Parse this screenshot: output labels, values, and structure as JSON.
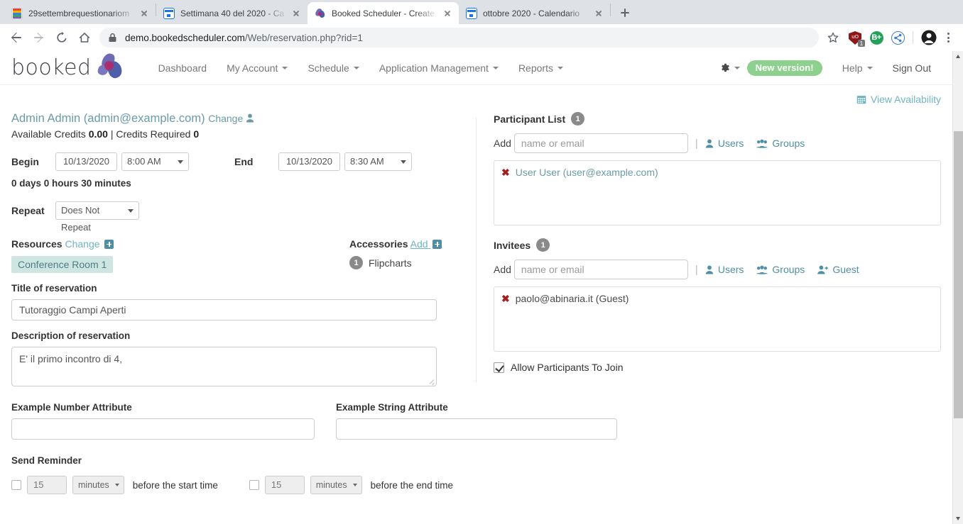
{
  "browser": {
    "tabs": [
      {
        "title": "29settembrequestionariom",
        "favicon": "forms-icon",
        "active": false
      },
      {
        "title": "Settimana 40 del 2020 - Ca",
        "favicon": "calendar-icon",
        "active": false
      },
      {
        "title": "Booked Scheduler - Create",
        "favicon": "booked-icon",
        "active": true
      },
      {
        "title": "ottobre 2020 - Calendario",
        "favicon": "calendar-icon",
        "active": false
      }
    ],
    "new_tab_label": "New Tab",
    "url_host": "demo.bookedscheduler.com",
    "url_path": "/Web/reservation.php?rid=1",
    "extensions": [
      {
        "name": "ublock-origin",
        "label": "uO",
        "badge": "1"
      },
      {
        "name": "bitwarden",
        "label": "B+"
      },
      {
        "name": "share",
        "label": ""
      }
    ]
  },
  "app": {
    "logo_text": "booked",
    "nav": [
      {
        "label": "Dashboard",
        "caret": false
      },
      {
        "label": "My Account",
        "caret": true
      },
      {
        "label": "Schedule",
        "caret": true
      },
      {
        "label": "Application Management",
        "caret": true
      },
      {
        "label": "Reports",
        "caret": true
      }
    ],
    "nav_right": {
      "new_version_label": "New version!",
      "help_label": "Help",
      "sign_out_label": "Sign Out"
    },
    "view_availability_label": "View Availability"
  },
  "reservation": {
    "owner": "Admin Admin (admin@example.com)",
    "owner_change_label": "Change",
    "credits_prefix": "Available Credits",
    "credits_available": "0.00",
    "credits_sep": "|",
    "credits_required_prefix": "Credits Required",
    "credits_required": "0",
    "begin_label": "Begin",
    "begin_date": "10/13/2020",
    "begin_time": "8:00 AM",
    "end_label": "End",
    "end_date": "10/13/2020",
    "end_time": "8:30 AM",
    "duration": "0 days 0 hours 30 minutes",
    "repeat_label": "Repeat",
    "repeat_value": "Does Not Repeat",
    "resources_label": "Resources",
    "resources_change_label": "Change",
    "resources": [
      "Conference Room 1"
    ],
    "accessories_label": "Accessories",
    "accessories_add_label": "Add",
    "accessories": [
      {
        "count": "1",
        "name": "Flipcharts"
      }
    ],
    "title_label": "Title of reservation",
    "title_value": "Tutoraggio Campi Aperti",
    "description_label": "Description of reservation",
    "description_value": "E' il primo incontro di 4,"
  },
  "participants": {
    "heading": "Participant List",
    "count": "1",
    "add_label": "Add",
    "add_placeholder": "name or email",
    "users_label": "Users",
    "groups_label": "Groups",
    "items": [
      {
        "text": "User User (user@example.com)"
      }
    ]
  },
  "invitees": {
    "heading": "Invitees",
    "count": "1",
    "add_label": "Add",
    "add_placeholder": "name or email",
    "users_label": "Users",
    "groups_label": "Groups",
    "guest_label": "Guest",
    "items": [
      {
        "text": "paolo@abinaria.it (Guest)"
      }
    ],
    "allow_join_label": "Allow Participants To Join",
    "allow_join_checked": true
  },
  "attributes": {
    "number_label": "Example Number Attribute",
    "number_value": "",
    "string_label": "Example String Attribute",
    "string_value": ""
  },
  "reminders": {
    "heading": "Send Reminder",
    "start": {
      "value": "15",
      "unit": "minutes",
      "text": "before the start time",
      "checked": false
    },
    "end": {
      "value": "15",
      "unit": "minutes",
      "text": "before the end time",
      "checked": false
    }
  },
  "colors": {
    "teal": "#6fb3c4",
    "teal_dark": "#4f8fa6",
    "chip_bg": "#cfe5e2",
    "green_badge": "#8ed18e",
    "gray_badge": "#8a8a8a",
    "red_x": "#a32020"
  }
}
